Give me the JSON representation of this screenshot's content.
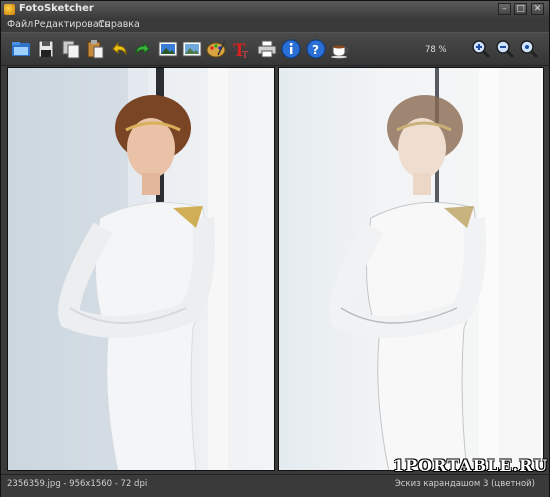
{
  "window": {
    "title": "FotoSketcher"
  },
  "menu": {
    "items": [
      "Файл",
      "Редактировать",
      "Справка"
    ]
  },
  "toolbar": {
    "zoom": "78 %",
    "icons": [
      "open-folder-icon",
      "save-icon",
      "copy-icon",
      "paste-icon",
      "undo-icon",
      "redo-icon",
      "original-image-icon",
      "result-image-icon",
      "palette-icon",
      "text-icon",
      "print-icon",
      "info-icon",
      "help-icon",
      "coffee-icon",
      "zoom-in-icon",
      "zoom-out-icon",
      "zoom-fit-icon"
    ]
  },
  "status": {
    "file_info": "2356359.jpg - 956x1560 - 72 dpi",
    "effect": "Эскиз карандашом 3 (цветной)"
  },
  "watermark": "1PORTABLE.RU"
}
